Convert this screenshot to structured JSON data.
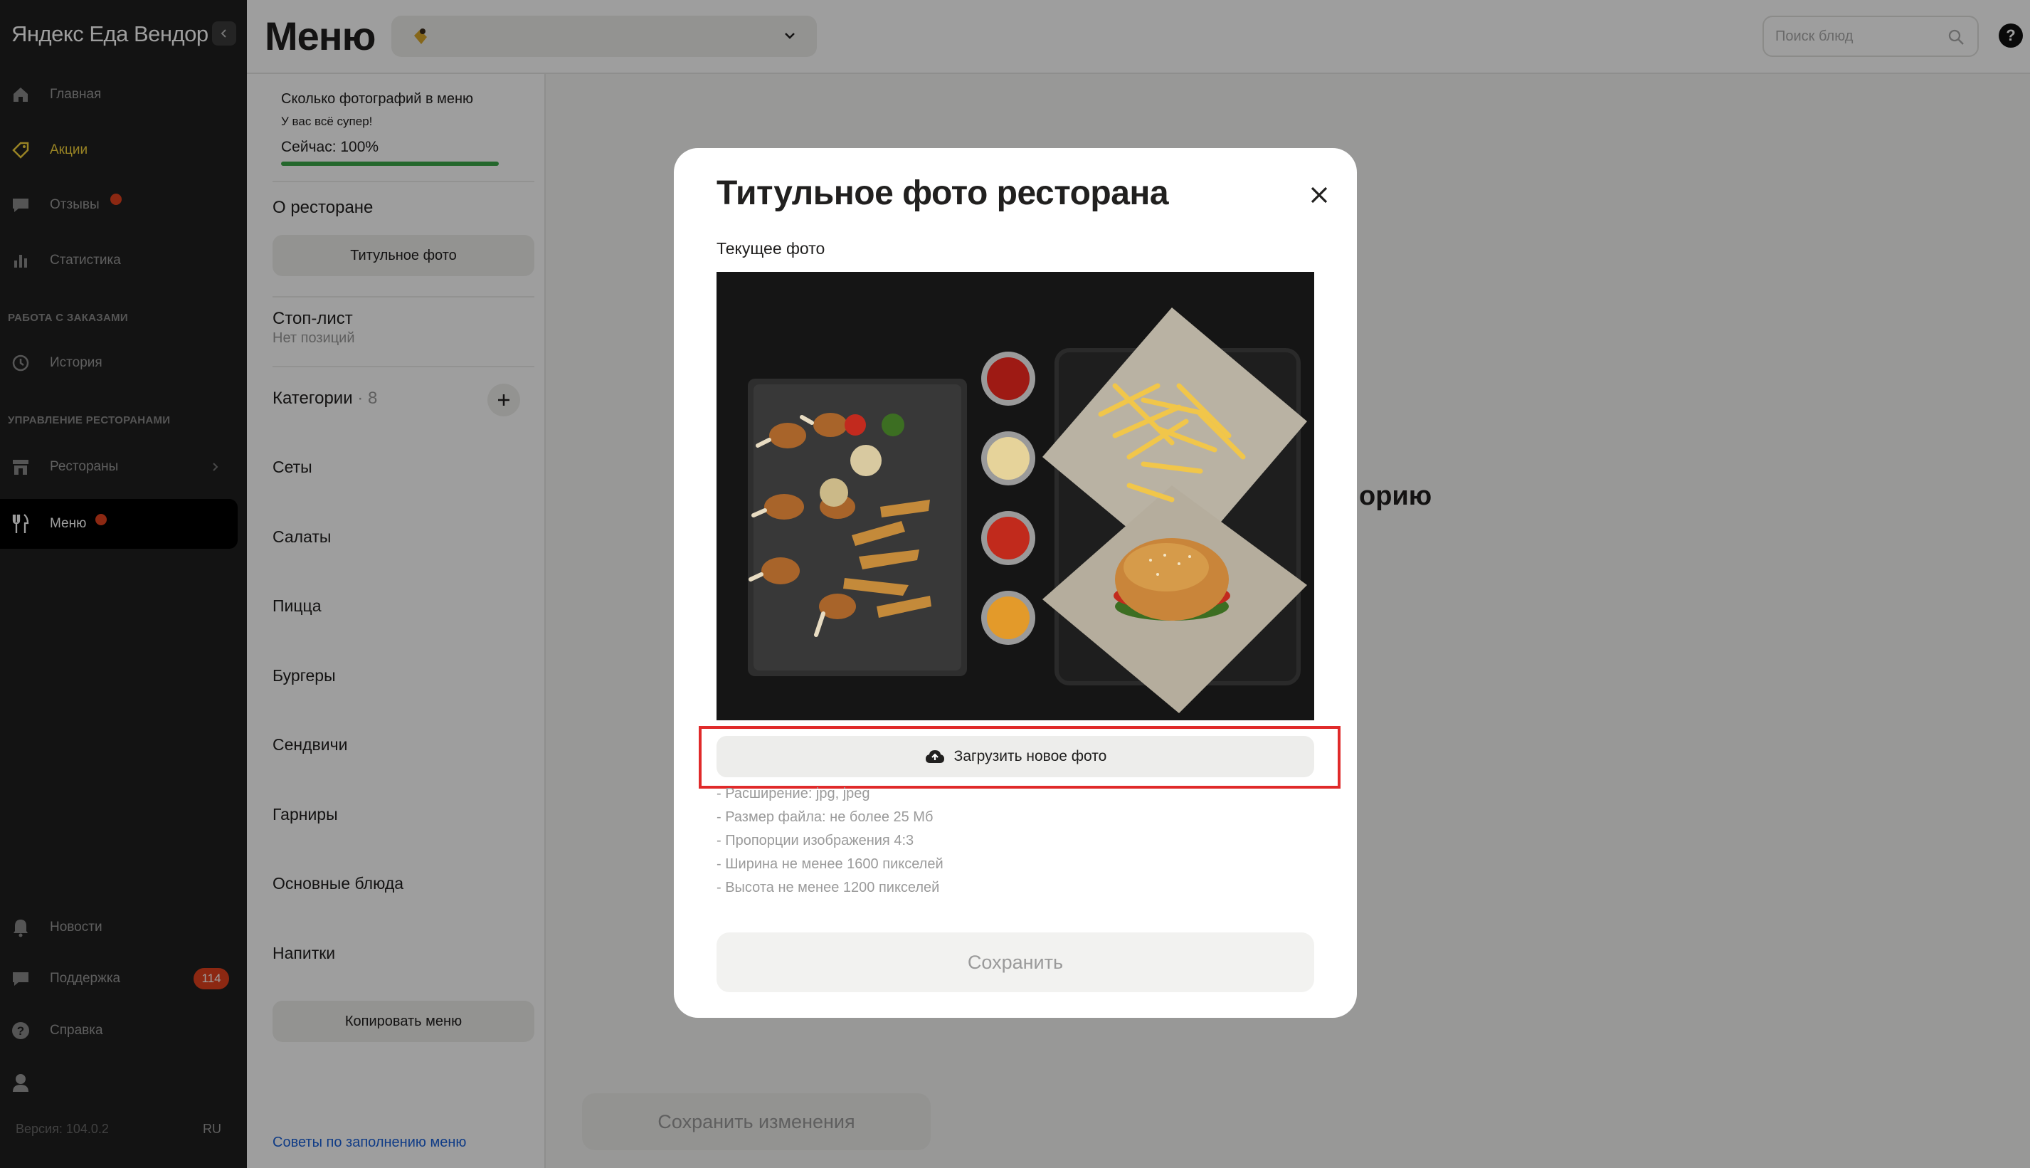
{
  "app": {
    "brand": "Яндекс Еда Вендор",
    "version": "Версия: 104.0.2",
    "lang": "RU"
  },
  "sidebar": {
    "items": [
      {
        "label": "Главная",
        "icon": "home-icon"
      },
      {
        "label": "Акции",
        "icon": "tag-icon"
      },
      {
        "label": "Отзывы",
        "icon": "chat-icon"
      },
      {
        "label": "Статистика",
        "icon": "bar-chart-icon"
      }
    ],
    "orders_section": "РАБОТА С ЗАКАЗАМИ",
    "history": "История",
    "restaurants_section": "УПРАВЛЕНИЕ РЕСТОРАНАМИ",
    "restaurants": "Рестораны",
    "menu": "Меню",
    "news": "Новости",
    "support": "Поддержка",
    "support_badge": "114",
    "help": "Справка"
  },
  "header": {
    "title": "Меню",
    "search_placeholder": "Поиск блюд"
  },
  "menu_panel": {
    "photo_stats_title": "Сколько фотографий в меню",
    "photo_stats_status": "У вас всё супер!",
    "photo_stats_now": "Сейчас: 100%",
    "photo_progress": 1.0,
    "about_title": "О ресторане",
    "title_photo_btn": "Титульное фото",
    "stoplist_title": "Стоп-лист",
    "stoplist_sub": "Нет позиций",
    "categories_title": "Категории",
    "categories_count": "· 8",
    "categories": [
      "Сеты",
      "Салаты",
      "Пицца",
      "Бургеры",
      "Сендвичи",
      "Гарниры",
      "Основные блюда",
      "Напитки"
    ],
    "copy_menu_btn": "Копировать меню",
    "tips_link": "Советы по заполнению меню"
  },
  "main": {
    "hint_fragment": "орию",
    "save_changes": "Сохранить изменения"
  },
  "modal": {
    "title": "Титульное фото ресторана",
    "current_photo_label": "Текущее фото",
    "upload_btn": "Загрузить новое фото",
    "requirements": [
      "- Расширение: jpg, jpeg",
      "- Размер файла: не более 25 Мб",
      "- Пропорции изображения 4:3",
      "- Ширина не менее 1600 пикселей",
      "- Высота не менее 1200 пикселей"
    ],
    "save_btn": "Сохранить"
  },
  "colors": {
    "sidebar_bg": "#1f1f1f",
    "accent_yellow": "#f5d33a",
    "badge_red": "#e2421d",
    "progress_green": "#3aa648",
    "highlight_red": "#e02a2a",
    "link_blue": "#1b61d8"
  }
}
